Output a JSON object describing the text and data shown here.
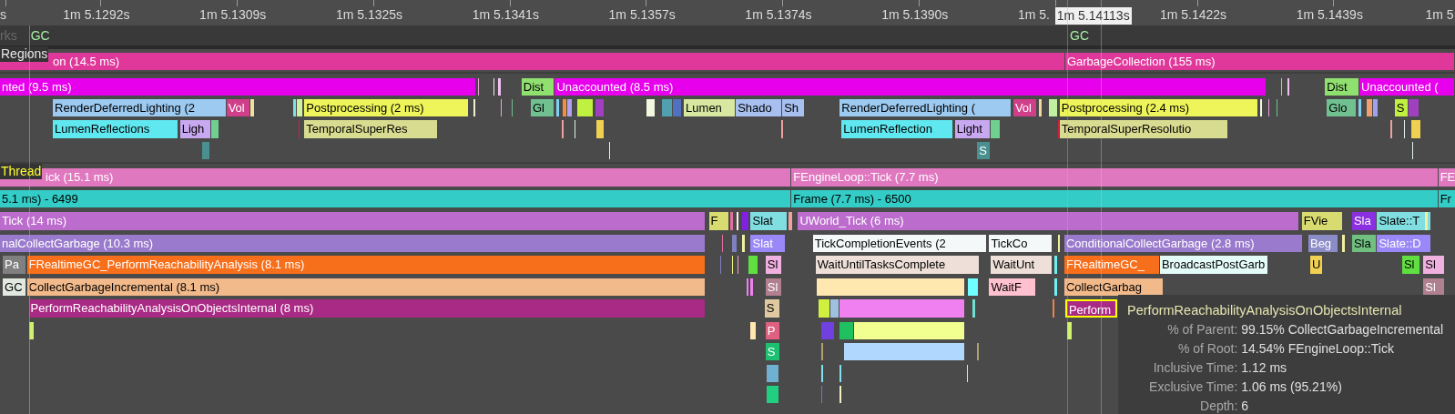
{
  "ruler": {
    "ticks": [
      "s",
      "1m 5.1292s",
      "1m 5.1309s",
      "1m 5.1325s",
      "1m 5.1341s",
      "1m 5.1357s",
      "1m 5.1374s",
      "1m 5.1390s",
      "1m 5.",
      "1m 5.1422s",
      "1m 5.1439s",
      "1m 5"
    ],
    "cursor_time": "1m 5.14113s"
  },
  "markers": {
    "label": "rks",
    "events": [
      {
        "text": "GC"
      },
      {
        "text": "GC"
      }
    ]
  },
  "tracks": [
    {
      "label": "Regions",
      "lanes": [
        {
          "events": [
            {
              "text": "on (14.5 ms)",
              "color": "#e0389a",
              "selected": false
            },
            {
              "text": "GarbageCollection (155 ms)",
              "color": "#e0389a",
              "selected": false
            }
          ]
        }
      ]
    },
    {
      "lanes": [
        {
          "events": [
            {
              "text": "nted (9.5 ms)",
              "color": "#e600ec",
              "selected": false
            },
            {
              "text": "Dist",
              "color": "#90e070",
              "selected": false
            },
            {
              "text": "Unaccounted (8.5 ms)",
              "color": "#e600ec",
              "selected": false
            },
            {
              "text": "Dist",
              "color": "#90e070",
              "selected": false
            },
            {
              "text": "Unaccounted (",
              "color": "#e600ec",
              "selected": false
            }
          ]
        },
        {
          "events": [
            {
              "text": "RenderDeferredLighting (2",
              "color": "#9ccaf0",
              "selected": false
            },
            {
              "text": "Vol",
              "color": "#d0408a",
              "selected": false
            },
            {
              "text": "Postprocessing (2 ms)",
              "color": "#eef55a",
              "selected": false
            },
            {
              "text": "Gl",
              "color": "#70c090",
              "selected": false
            },
            {
              "text": "Lumen",
              "color": "#d8e8a0",
              "selected": false
            },
            {
              "text": "Shado",
              "color": "#a8c0f0",
              "selected": false
            },
            {
              "text": "Sh",
              "color": "#a8c0f0",
              "selected": false
            },
            {
              "text": "RenderDeferredLighting (",
              "color": "#9ccaf0",
              "selected": false
            },
            {
              "text": "Vol",
              "color": "#d0408a",
              "selected": false
            },
            {
              "text": "Postprocessing (2.4 ms)",
              "color": "#eef55a",
              "selected": false
            },
            {
              "text": "Glo",
              "color": "#70c090",
              "selected": false
            },
            {
              "text": "S",
              "color": "#c0f040",
              "selected": false
            }
          ]
        },
        {
          "events": [
            {
              "text": "LumenReflections",
              "color": "#60e8f0",
              "selected": false
            },
            {
              "text": "Ligh",
              "color": "#c8a8f0",
              "selected": false
            },
            {
              "text": "TemporalSuperRes",
              "color": "#d8dc90",
              "selected": false
            },
            {
              "text": "LumenReflection",
              "color": "#60e8f0",
              "selected": false
            },
            {
              "text": "Light",
              "color": "#c8a8f0",
              "selected": false
            },
            {
              "text": "TemporalSuperResolutio",
              "color": "#d8dc90",
              "selected": false
            }
          ]
        },
        {
          "events": [
            {
              "text": "S",
              "color": "#4a9090",
              "selected": false
            }
          ]
        }
      ]
    },
    {
      "label": "Thread",
      "lanes": [
        {
          "events": [
            {
              "text": "ick (15.1 ms)",
              "color": "#e078c0",
              "selected": false
            },
            {
              "text": "FEngineLoop::Tick (7.7 ms)",
              "color": "#e078c0",
              "selected": false
            },
            {
              "text": "FE",
              "color": "#e078c0",
              "selected": false
            }
          ]
        },
        {
          "events": [
            {
              "text": "5.1 ms) -  6499",
              "color": "#33ccc6",
              "selected": false
            },
            {
              "text": "Frame (7.7 ms) -  6500",
              "color": "#33ccc6",
              "selected": false
            },
            {
              "text": "Fr",
              "color": "#33ccc6",
              "selected": false
            }
          ]
        },
        {
          "events": [
            {
              "text": "Tick (14 ms)",
              "color": "#bb6ccc",
              "selected": false
            },
            {
              "text": "F",
              "color": "#d8dc70",
              "selected": false
            },
            {
              "text": "Slat",
              "color": "#80dde0",
              "selected": false
            },
            {
              "text": "UWorld_Tick (6 ms)",
              "color": "#bb6ccc",
              "selected": false
            },
            {
              "text": "FVie",
              "color": "#d8dc70",
              "selected": false
            },
            {
              "text": "Sla",
              "color": "#8a30e0",
              "selected": false
            },
            {
              "text": "Slate::T",
              "color": "#80dde0",
              "selected": false
            }
          ]
        },
        {
          "events": [
            {
              "text": "nalCollectGarbage (10.3 ms)",
              "color": "#9a7acc",
              "selected": false
            },
            {
              "text": "Slat",
              "color": "#9a88f8",
              "selected": false
            },
            {
              "text": "TickCompletionEvents (2",
              "color": "#f4f8f8",
              "selected": false
            },
            {
              "text": "TickCo",
              "color": "#f4f8f8",
              "selected": false
            },
            {
              "text": "ConditionalCollectGarbage (2.8 ms)",
              "color": "#9a7acc",
              "selected": false
            },
            {
              "text": "Beg",
              "color": "#8c8cc8",
              "selected": false
            },
            {
              "text": "Sla",
              "color": "#70c080",
              "selected": false
            },
            {
              "text": "Slate::D",
              "color": "#9a88f8",
              "selected": false
            }
          ]
        },
        {
          "events": [
            {
              "text": "Pa",
              "color": "#808080",
              "selected": false
            },
            {
              "text": "FRealtimeGC_PerformReachabilityAnalysis (8.1 ms)",
              "color": "#f76f1a",
              "selected": false
            },
            {
              "text": "Sl",
              "color": "#f0b0e0",
              "selected": false
            },
            {
              "text": "WaitUntilTasksComplete",
              "color": "#eee0d8",
              "selected": false
            },
            {
              "text": "WaitUnt",
              "color": "#eee0d8",
              "selected": false
            },
            {
              "text": "FRealtimeGC_",
              "color": "#f76f1a",
              "selected": false
            },
            {
              "text": "BroadcastPostGarb",
              "color": "#e4fcf8",
              "selected": false
            },
            {
              "text": "U",
              "color": "#f0d050",
              "selected": false
            },
            {
              "text": "Sl",
              "color": "#60e040",
              "selected": false
            },
            {
              "text": "Sl",
              "color": "#f0b0e0",
              "selected": false
            }
          ]
        },
        {
          "events": [
            {
              "text": "GC",
              "color": "#e0e8e0",
              "selected": false
            },
            {
              "text": "CollectGarbageIncremental (8.1 ms)",
              "color": "#f2b98a",
              "selected": false
            },
            {
              "text": "Sl",
              "color": "#b08090",
              "selected": false
            },
            {
              "text": "WaitF",
              "color": "#ffc0d0",
              "selected": false
            },
            {
              "text": "CollectGarbag",
              "color": "#f2b98a",
              "selected": false
            },
            {
              "text": "Sl",
              "color": "#b08090",
              "selected": false
            }
          ]
        },
        {
          "events": [
            {
              "text": "PerformReachabilityAnalysisOnObjectsInternal (8 ms)",
              "color": "#a92a84",
              "selected": false
            },
            {
              "text": "S",
              "color": "#e0c8a0",
              "selected": false
            },
            {
              "text": "Perform",
              "color": "#a92a84",
              "selected": true
            }
          ]
        },
        {
          "events": [
            {
              "text": "P",
              "color": "#e06080",
              "selected": false
            }
          ]
        },
        {
          "events": [
            {
              "text": "S",
              "color": "#1cc070",
              "selected": false
            }
          ]
        }
      ]
    }
  ],
  "tooltip": {
    "title": "PerformReachabilityAnalysisOnObjectsInternal",
    "rows": [
      {
        "label": "% of Parent:",
        "value": "99.15% CollectGarbageIncremental"
      },
      {
        "label": "% of Root:",
        "value": "14.54% FEngineLoop::Tick"
      },
      {
        "label": "Inclusive Time:",
        "value": "1.12 ms"
      },
      {
        "label": "Exclusive Time:",
        "value": "1.06 ms (95.21%)"
      },
      {
        "label": "Depth:",
        "value": "6"
      }
    ]
  }
}
